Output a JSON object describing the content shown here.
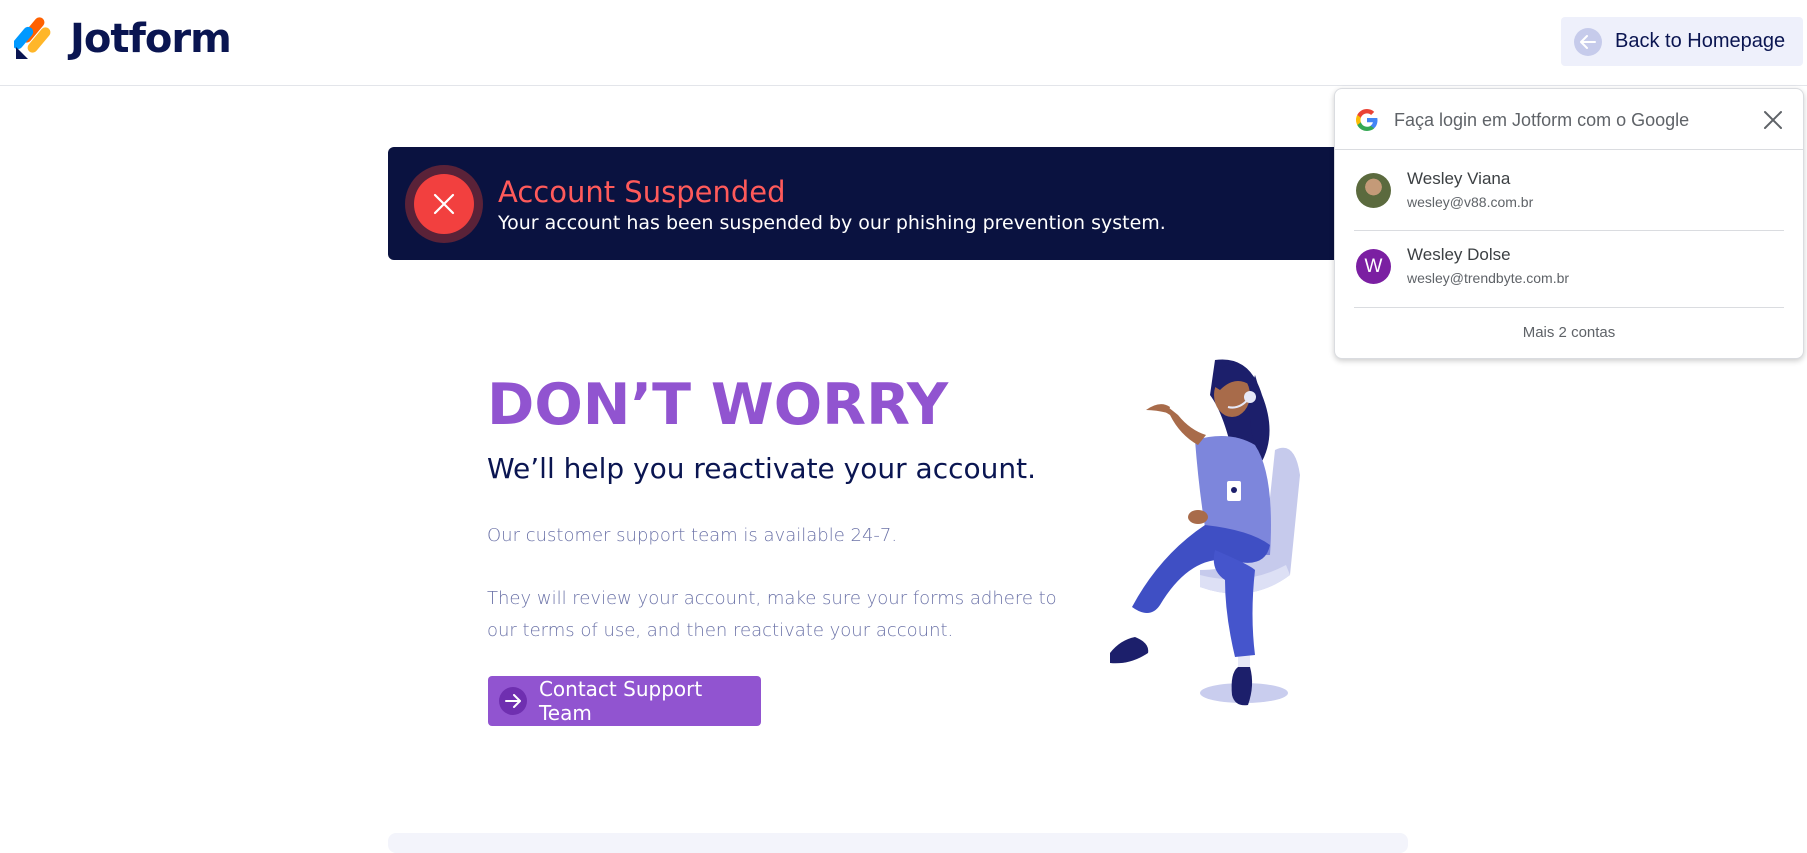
{
  "header": {
    "logo_text": "Jotform",
    "back_label": "Back to Homepage"
  },
  "banner": {
    "title": "Account Suspended",
    "subtitle": "Your account has been suspended by our phishing prevention system."
  },
  "main": {
    "headline": "DON’T WORRY",
    "subhead": "We’ll help you reactivate your account.",
    "para1": "Our customer support team is available 24-7.",
    "para2": "They will review your account, make sure your forms adhere to our terms of use, and then reactivate your account.",
    "cta_label": "Contact Support Team"
  },
  "google_popup": {
    "title": "Faça login em Jotform com o Google",
    "accounts": [
      {
        "name": "Wesley Viana",
        "email": "wesley@v88.com.br",
        "avatar": "photo"
      },
      {
        "name": "Wesley Dolse",
        "email": "wesley@trendbyte.com.br",
        "avatar": "W"
      }
    ],
    "more": "Mais 2 contas"
  },
  "colors": {
    "brand_navy": "#0a1551",
    "banner_bg": "#0a1240",
    "alert_red": "#f2403f",
    "purple": "#9154d0"
  }
}
